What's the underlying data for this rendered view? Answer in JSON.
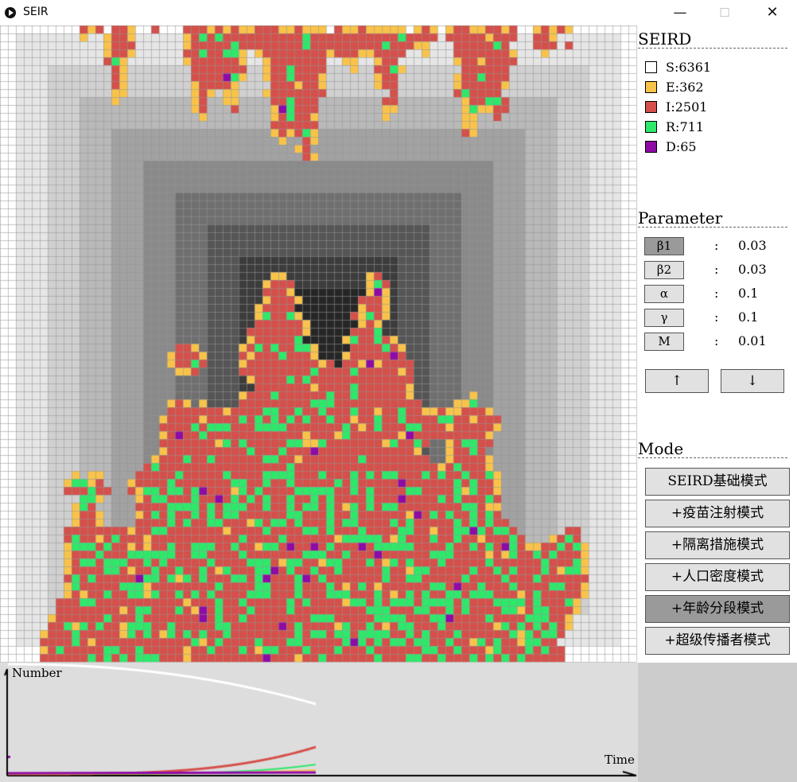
{
  "window": {
    "title": "SEIR",
    "min_glyph": "—",
    "max_glyph": "☐",
    "close_glyph": "✕"
  },
  "legend": {
    "title": "SEIRD",
    "items": [
      {
        "label": "S:6361",
        "color": "#ffffff"
      },
      {
        "label": "E:362",
        "color": "#f9c34a"
      },
      {
        "label": "I:2501",
        "color": "#d5504a"
      },
      {
        "label": "R:711",
        "color": "#2ee86a"
      },
      {
        "label": "D:65",
        "color": "#8e0ba6"
      }
    ]
  },
  "parameters": {
    "title": "Parameter",
    "rows": [
      {
        "name": "β1",
        "value": "0.03",
        "active": true
      },
      {
        "name": "β2",
        "value": "0.03",
        "active": false
      },
      {
        "name": "α",
        "value": "0.1",
        "active": false
      },
      {
        "name": "γ",
        "value": "0.1",
        "active": false
      },
      {
        "name": "M",
        "value": "0.01",
        "active": false
      }
    ],
    "colon": ":",
    "up_label": "↑",
    "down_label": "↓"
  },
  "mode": {
    "title": "Mode",
    "buttons": [
      {
        "label": "SEIRD基础模式",
        "active": false
      },
      {
        "label": "+疫苗注射模式",
        "active": false
      },
      {
        "label": "+隔离措施模式",
        "active": false
      },
      {
        "label": "+人口密度模式",
        "active": false
      },
      {
        "label": "+年龄分段模式",
        "active": true
      },
      {
        "label": "+超级传播者模式",
        "active": false
      }
    ]
  },
  "plot": {
    "y_label": "Number",
    "x_label": "Time"
  }
}
